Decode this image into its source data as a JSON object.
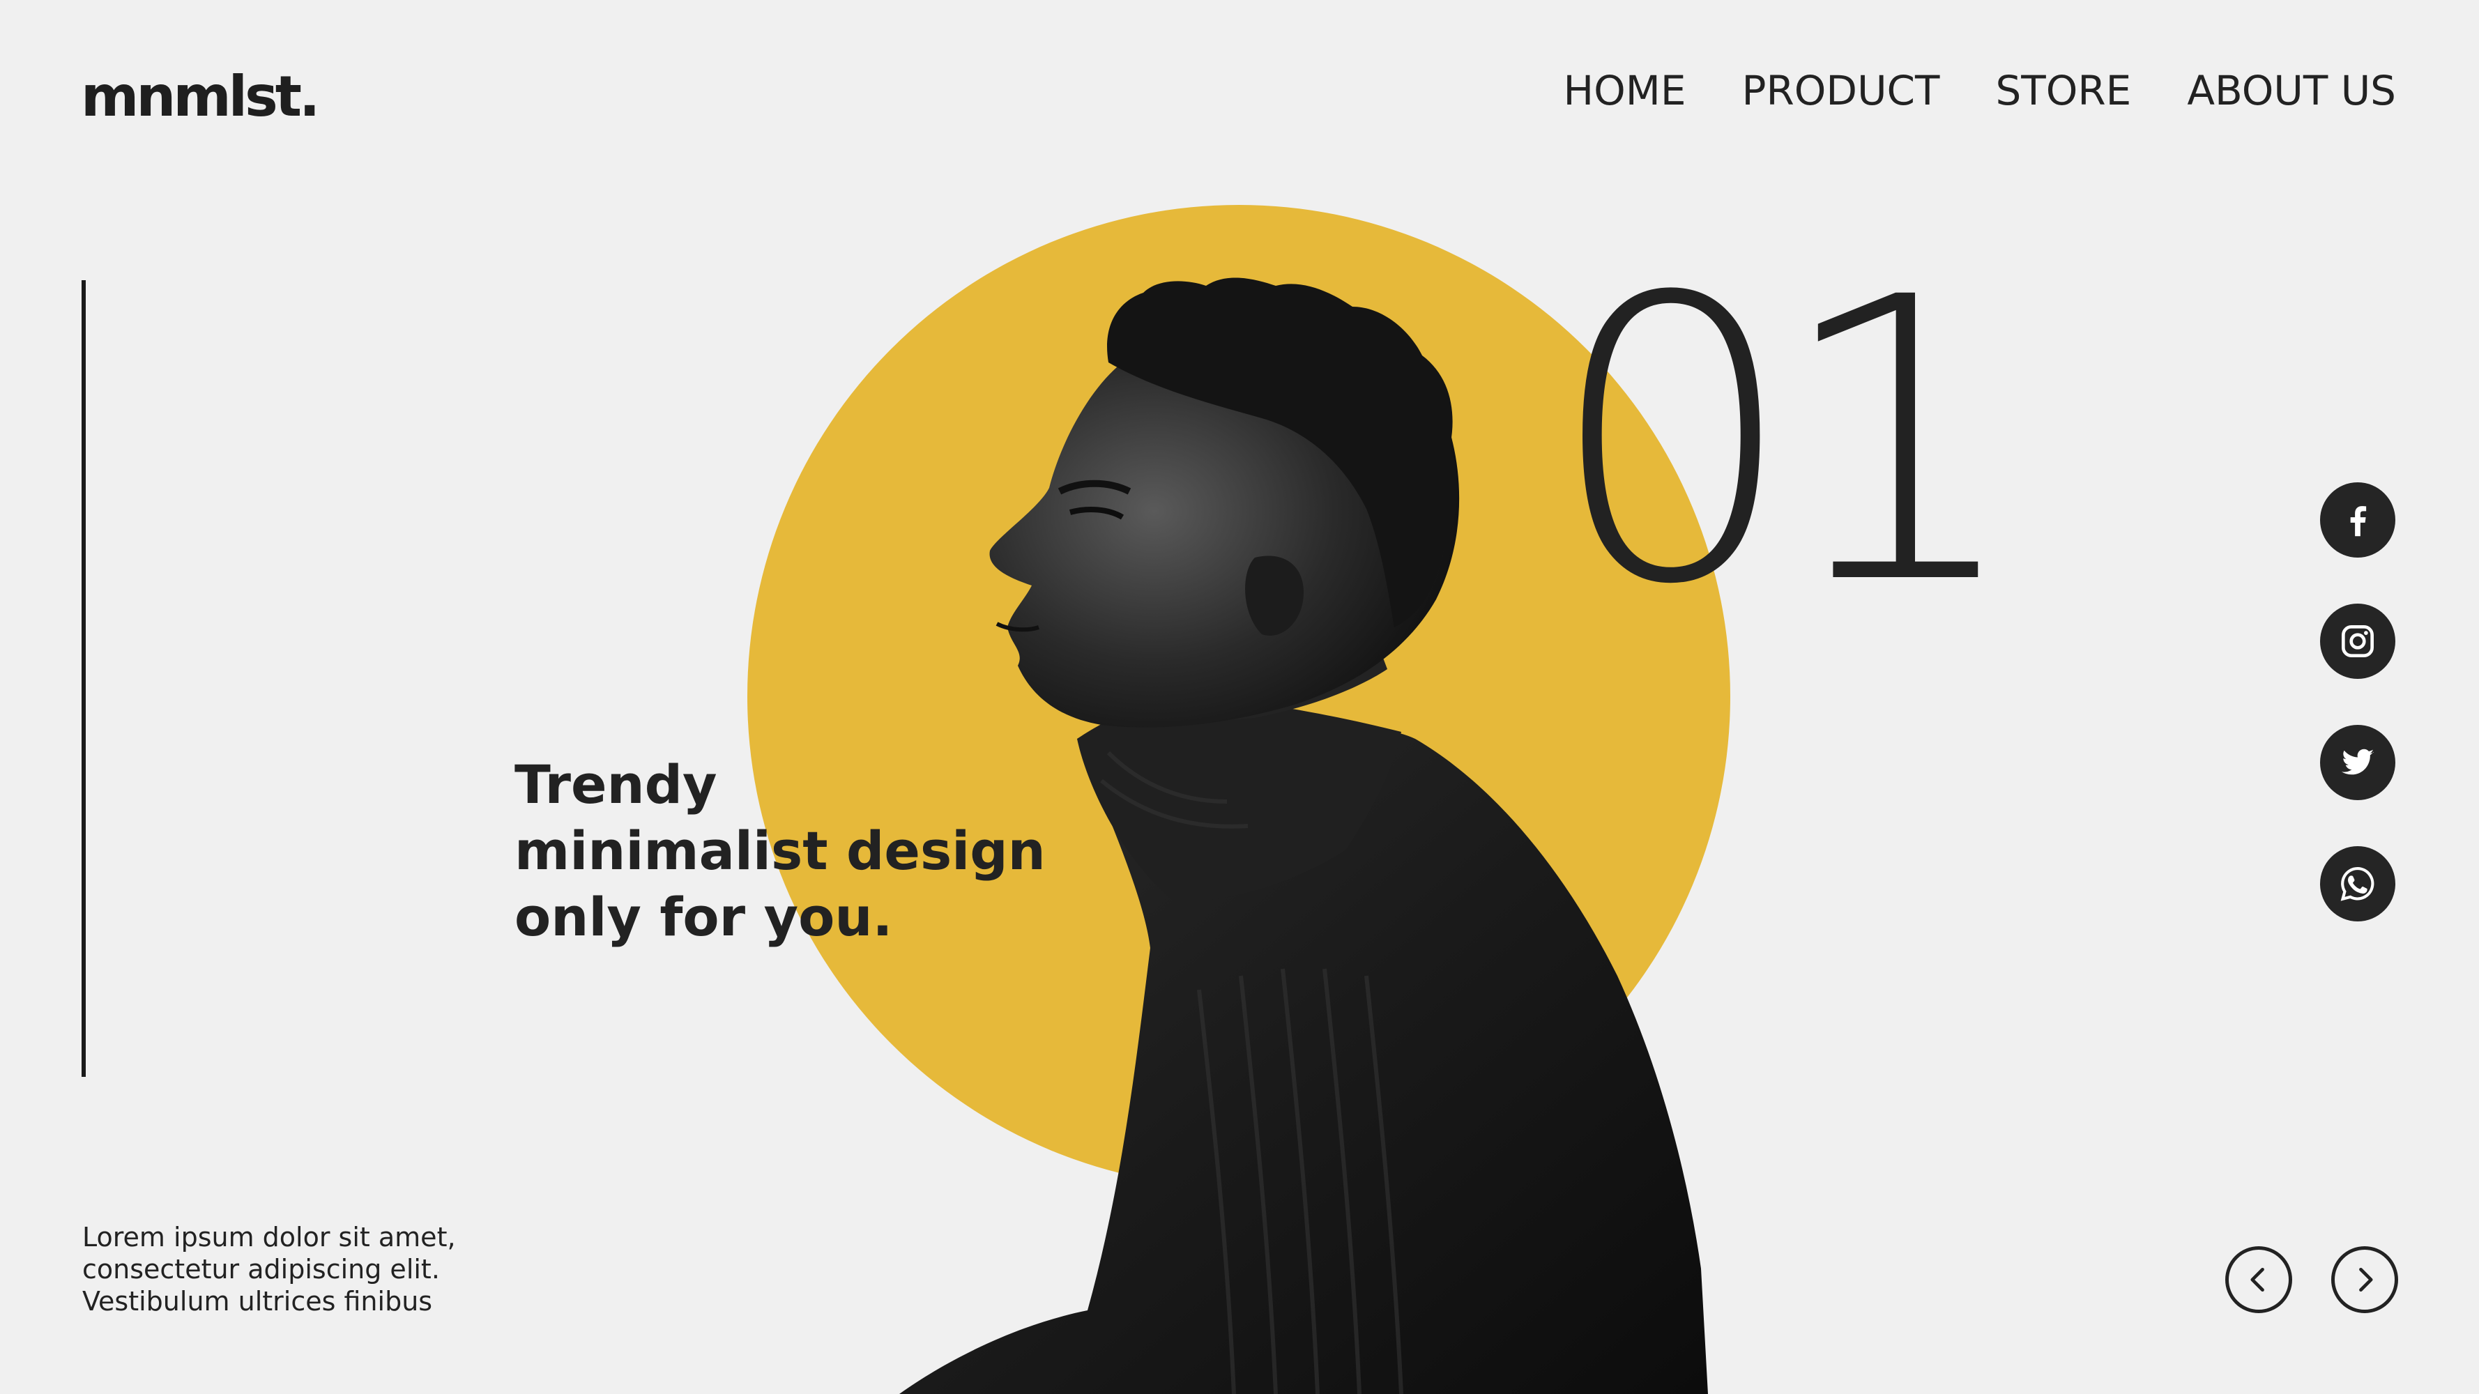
{
  "brand": {
    "logo": "mnmlst."
  },
  "nav": {
    "items": [
      {
        "label": "HOME"
      },
      {
        "label": "PRODUCT"
      },
      {
        "label": "STORE"
      },
      {
        "label": "ABOUT US"
      }
    ]
  },
  "hero": {
    "slide_number": "01",
    "headline": [
      "Trendy",
      "minimalist design",
      "only for you."
    ],
    "accent_color": "#e6b93a"
  },
  "body_copy": [
    "Lorem ipsum dolor sit amet,",
    "consectetur adipiscing elit.",
    "Vestibulum ultrices finibus"
  ],
  "social": [
    {
      "icon": "facebook-icon"
    },
    {
      "icon": "instagram-icon"
    },
    {
      "icon": "twitter-icon"
    },
    {
      "icon": "whatsapp-icon"
    }
  ],
  "slider": {
    "prev_icon": "chevron-left-icon",
    "next_icon": "chevron-right-icon"
  }
}
